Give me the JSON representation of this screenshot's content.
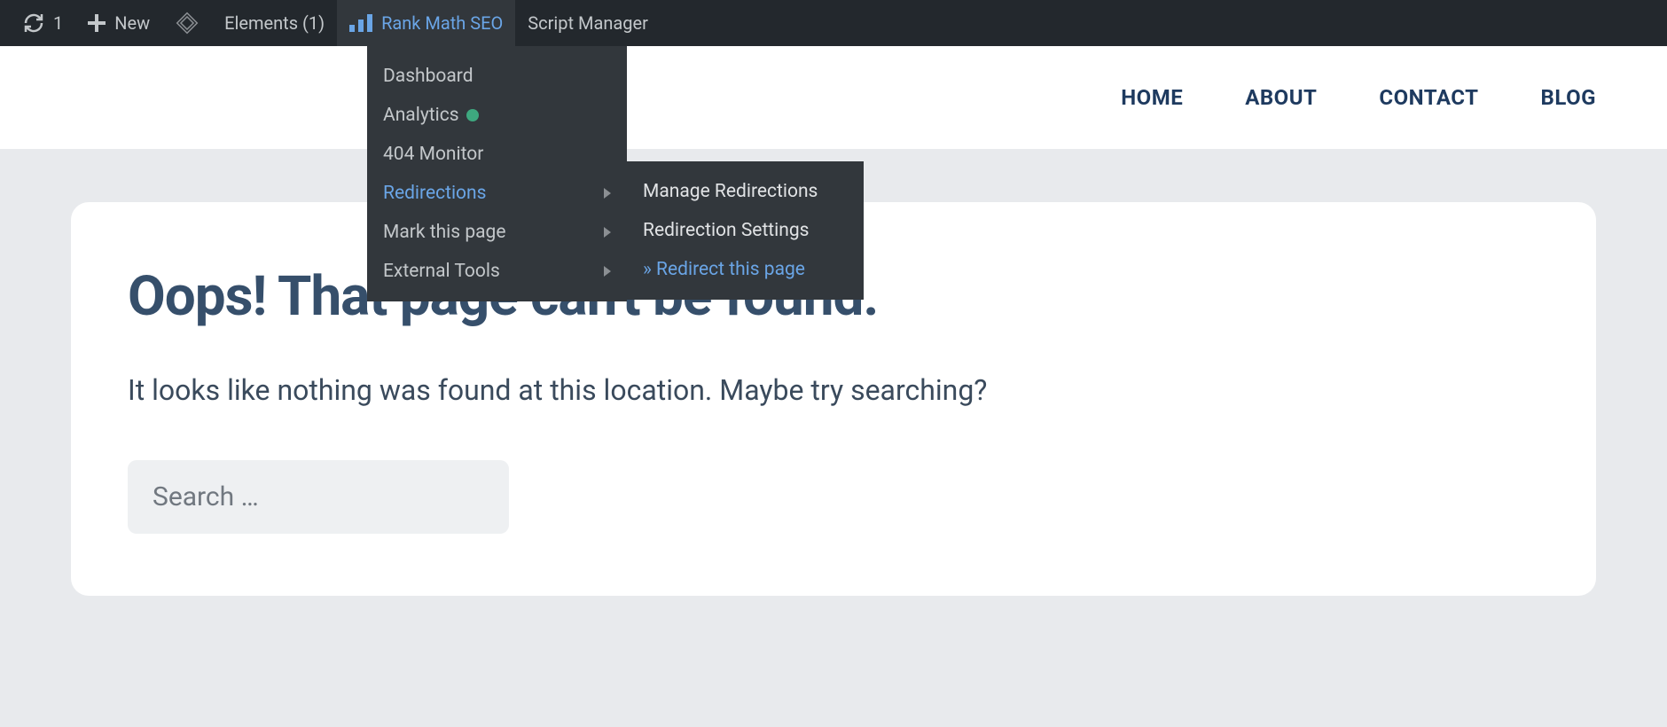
{
  "adminBar": {
    "refreshCount": "1",
    "newLabel": "New",
    "elementsLabel": "Elements (1)",
    "rankMathLabel": "Rank Math SEO",
    "scriptManagerLabel": "Script Manager"
  },
  "dropdown": {
    "dashboard": "Dashboard",
    "analytics": "Analytics",
    "monitor404": "404 Monitor",
    "redirections": "Redirections",
    "markPage": "Mark this page",
    "externalTools": "External Tools"
  },
  "submenu": {
    "manageRedirections": "Manage Redirections",
    "redirectionSettings": "Redirection Settings",
    "redirectThisPage": "» Redirect this page"
  },
  "nav": {
    "home": "HOME",
    "about": "ABOUT",
    "contact": "CONTACT",
    "blog": "BLOG"
  },
  "page404": {
    "heading": "Oops! That page can't be found.",
    "message": "It looks like nothing was found at this location. Maybe try searching?",
    "searchPlaceholder": "Search …"
  }
}
